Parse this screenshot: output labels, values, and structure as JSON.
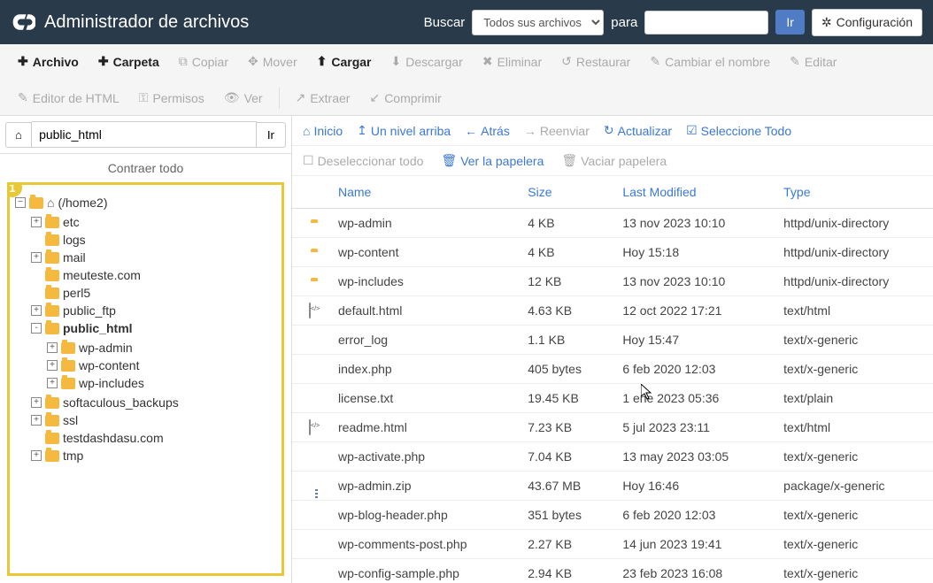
{
  "header": {
    "title": "Administrador de archivos",
    "search_label": "Buscar",
    "search_select": "Todos sus archivos",
    "for_label": "para",
    "search_value": "",
    "go": "Ir",
    "config": "Configuración"
  },
  "toolbar": {
    "row1": [
      {
        "icon": "plus",
        "label": "Archivo",
        "bold": true
      },
      {
        "icon": "plus",
        "label": "Carpeta",
        "bold": true
      },
      {
        "icon": "copy",
        "label": "Copiar",
        "disabled": true
      },
      {
        "icon": "move",
        "label": "Mover",
        "disabled": true
      },
      {
        "icon": "upload",
        "label": "Cargar",
        "bold": true
      },
      {
        "icon": "download",
        "label": "Descargar",
        "disabled": true
      },
      {
        "icon": "x",
        "label": "Eliminar",
        "disabled": true
      },
      {
        "icon": "restore",
        "label": "Restaurar",
        "disabled": true
      },
      {
        "icon": "rename",
        "label": "Cambiar el nombre",
        "disabled": true
      },
      {
        "icon": "edit",
        "label": "Editar",
        "disabled": true
      }
    ],
    "row2": [
      {
        "icon": "html",
        "label": "Editor de HTML",
        "disabled": true
      },
      {
        "icon": "key",
        "label": "Permisos",
        "disabled": true
      },
      {
        "icon": "eye",
        "label": "Ver",
        "disabled": true
      },
      {
        "sep": true
      },
      {
        "icon": "extract",
        "label": "Extraer",
        "disabled": true
      },
      {
        "icon": "compress",
        "label": "Comprimir",
        "disabled": true
      }
    ]
  },
  "sidebar": {
    "path_value": "public_html",
    "go": "Ir",
    "collapse_all": "Contraer todo",
    "badge": "1",
    "tree": {
      "root_label": "(/home2)",
      "items": [
        {
          "toggle": "+",
          "label": "etc"
        },
        {
          "toggle": "",
          "label": "logs"
        },
        {
          "toggle": "+",
          "label": "mail"
        },
        {
          "toggle": "",
          "label": "meuteste.com"
        },
        {
          "toggle": "",
          "label": "perl5"
        },
        {
          "toggle": "+",
          "label": "public_ftp"
        },
        {
          "toggle": "-",
          "label": "public_html",
          "bold": true,
          "children": [
            {
              "toggle": "+",
              "label": "wp-admin"
            },
            {
              "toggle": "+",
              "label": "wp-content"
            },
            {
              "toggle": "+",
              "label": "wp-includes"
            }
          ]
        },
        {
          "toggle": "+",
          "label": "softaculous_backups"
        },
        {
          "toggle": "+",
          "label": "ssl"
        },
        {
          "toggle": "",
          "label": "testdashdasu.com"
        },
        {
          "toggle": "+",
          "label": "tmp"
        }
      ]
    }
  },
  "content_toolbar": {
    "home": "Inicio",
    "up": "Un nivel arriba",
    "back": "Atrás",
    "forward": "Reenviar",
    "reload": "Actualizar",
    "select_all": "Seleccione Todo",
    "deselect_all": "Deseleccionar todo",
    "view_trash": "Ver la papelera",
    "empty_trash": "Vaciar papelera"
  },
  "table": {
    "headers": {
      "name": "Name",
      "size": "Size",
      "modified": "Last Modified",
      "type": "Type"
    },
    "rows": [
      {
        "icon": "folder",
        "name": "wp-admin",
        "size": "4 KB",
        "modified": "13 nov 2023 10:10",
        "type": "httpd/unix-directory"
      },
      {
        "icon": "folder",
        "name": "wp-content",
        "size": "4 KB",
        "modified": "Hoy 15:18",
        "type": "httpd/unix-directory"
      },
      {
        "icon": "folder",
        "name": "wp-includes",
        "size": "12 KB",
        "modified": "13 nov 2023 10:10",
        "type": "httpd/unix-directory"
      },
      {
        "icon": "code",
        "name": "default.html",
        "size": "4.63 KB",
        "modified": "12 oct 2022 17:21",
        "type": "text/html"
      },
      {
        "icon": "doc",
        "name": "error_log",
        "size": "1.1 KB",
        "modified": "Hoy 15:47",
        "type": "text/x-generic"
      },
      {
        "icon": "doc",
        "name": "index.php",
        "size": "405 bytes",
        "modified": "6 feb 2020 12:03",
        "type": "text/x-generic"
      },
      {
        "icon": "doc",
        "name": "license.txt",
        "size": "19.45 KB",
        "modified": "1 ene 2023 05:36",
        "type": "text/plain"
      },
      {
        "icon": "code",
        "name": "readme.html",
        "size": "7.23 KB",
        "modified": "5 jul 2023 23:11",
        "type": "text/html"
      },
      {
        "icon": "doc",
        "name": "wp-activate.php",
        "size": "7.04 KB",
        "modified": "13 may 2023 03:05",
        "type": "text/x-generic"
      },
      {
        "icon": "zip",
        "name": "wp-admin.zip",
        "size": "43.67 MB",
        "modified": "Hoy 16:46",
        "type": "package/x-generic"
      },
      {
        "icon": "doc",
        "name": "wp-blog-header.php",
        "size": "351 bytes",
        "modified": "6 feb 2020 12:03",
        "type": "text/x-generic"
      },
      {
        "icon": "doc",
        "name": "wp-comments-post.php",
        "size": "2.27 KB",
        "modified": "14 jun 2023 19:41",
        "type": "text/x-generic"
      },
      {
        "icon": "doc",
        "name": "wp-config-sample.php",
        "size": "2.94 KB",
        "modified": "23 feb 2023 16:08",
        "type": "text/x-generic"
      }
    ]
  }
}
